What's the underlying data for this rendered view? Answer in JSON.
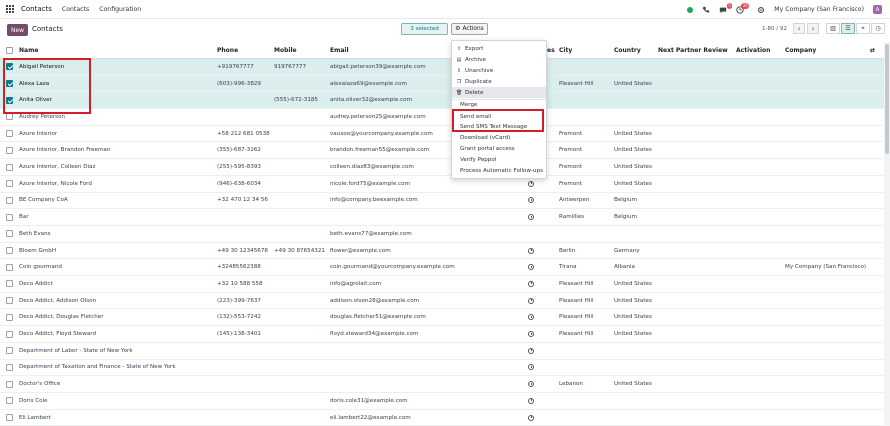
{
  "navbar": {
    "app_name": "Contacts",
    "menu": [
      "Contacts",
      "Configuration"
    ],
    "badge_chat": "5",
    "badge_activity": "26",
    "company": "My Company (San Francisco)",
    "avatar_letter": "A"
  },
  "control": {
    "new_label": "New",
    "title": "Contacts",
    "selected_label": "3 selected",
    "actions_label": "Actions",
    "pager": "1-80 / 92"
  },
  "columns": {
    "name": "Name",
    "phone": "Phone",
    "mobile": "Mobile",
    "email": "Email",
    "activities_partial": "es",
    "city": "City",
    "country": "Country",
    "next_partner_review": "Next Partner Review",
    "activation": "Activation",
    "company": "Company"
  },
  "rows": [
    {
      "name": "Abigail Peterson",
      "phone": "+919767777",
      "mobile": "919767777",
      "email": "abigail.peterson39@example.com",
      "city": "",
      "country": "",
      "company": "",
      "selected": true,
      "activity": false
    },
    {
      "name": "Alexa Laza",
      "phone": "(603)-996-3829",
      "mobile": "",
      "email": "alexalaza69@example.com",
      "city": "Pleasant Hill",
      "country": "United States",
      "company": "",
      "selected": true,
      "activity": false
    },
    {
      "name": "Anita Oliver",
      "phone": "",
      "mobile": "(555)-672-3185",
      "email": "anita.oliver32@example.com",
      "city": "",
      "country": "",
      "company": "",
      "selected": true,
      "activity": false
    },
    {
      "name": "Audrey Peterson",
      "phone": "",
      "mobile": "",
      "email": "audrey.peterson25@example.com",
      "city": "",
      "country": "",
      "company": "",
      "selected": false,
      "activity": false
    },
    {
      "name": "Azure Interior",
      "phone": "+58 212 681 0538",
      "mobile": "",
      "email": "vauxoo@yourcompany.example.com",
      "city": "Fremont",
      "country": "United States",
      "company": "",
      "selected": false,
      "activity": true
    },
    {
      "name": "Azure Interior, Brandon Freeman",
      "phone": "(355)-687-3262",
      "mobile": "",
      "email": "brandon.freeman55@example.com",
      "city": "Fremont",
      "country": "United States",
      "company": "",
      "selected": false,
      "activity": true
    },
    {
      "name": "Azure Interior, Colleen Diaz",
      "phone": "(255)-595-8393",
      "mobile": "",
      "email": "colleen.diaz83@example.com",
      "city": "Fremont",
      "country": "United States",
      "company": "",
      "selected": false,
      "activity": true
    },
    {
      "name": "Azure Interior, Nicole Ford",
      "phone": "(946)-638-6034",
      "mobile": "",
      "email": "nicole.ford75@example.com",
      "city": "Fremont",
      "country": "United States",
      "company": "",
      "selected": false,
      "activity": true
    },
    {
      "name": "BE Company CoA",
      "phone": "+32 470 12 34 56",
      "mobile": "",
      "email": "info@company.beexample.com",
      "city": "Antwerpen",
      "country": "Belgium",
      "company": "",
      "selected": false,
      "activity": true
    },
    {
      "name": "Bar",
      "phone": "",
      "mobile": "",
      "email": "",
      "city": "Ramillies",
      "country": "Belgium",
      "company": "",
      "selected": false,
      "activity": true
    },
    {
      "name": "Beth Evans",
      "phone": "",
      "mobile": "",
      "email": "beth.evans77@example.com",
      "city": "",
      "country": "",
      "company": "",
      "selected": false,
      "activity": false
    },
    {
      "name": "Bloem GmbH",
      "phone": "+49 30 12345678",
      "mobile": "+49 30 87654321",
      "email": "flower@example.com",
      "city": "Berlin",
      "country": "Germany",
      "company": "",
      "selected": false,
      "activity": true
    },
    {
      "name": "Coin gourmand",
      "phone": "+32485562388",
      "mobile": "",
      "email": "coin.gourmand@yourcompany.example.com",
      "city": "Tirana",
      "country": "Albania",
      "company": "My Company (San Francisco)",
      "selected": false,
      "activity": true
    },
    {
      "name": "Deco Addict",
      "phone": "+32 10 588 558",
      "mobile": "",
      "email": "info@agrolait.com",
      "city": "Pleasant Hill",
      "country": "United States",
      "company": "",
      "selected": false,
      "activity": true
    },
    {
      "name": "Deco Addict, Addison Olson",
      "phone": "(223)-399-7637",
      "mobile": "",
      "email": "addison.olson28@example.com",
      "city": "Pleasant Hill",
      "country": "United States",
      "company": "",
      "selected": false,
      "activity": true
    },
    {
      "name": "Deco Addict, Douglas Fletcher",
      "phone": "(132)-553-7242",
      "mobile": "",
      "email": "douglas.fletcher51@example.com",
      "city": "Pleasant Hill",
      "country": "United States",
      "company": "",
      "selected": false,
      "activity": true
    },
    {
      "name": "Deco Addict, Floyd Steward",
      "phone": "(145)-138-3401",
      "mobile": "",
      "email": "floyd.steward34@example.com",
      "city": "Pleasant Hill",
      "country": "United States",
      "company": "",
      "selected": false,
      "activity": true
    },
    {
      "name": "Department of Labor - State of New York",
      "phone": "",
      "mobile": "",
      "email": "",
      "city": "",
      "country": "",
      "company": "",
      "selected": false,
      "activity": true
    },
    {
      "name": "Department of Taxation and Finance - State of New York",
      "phone": "",
      "mobile": "",
      "email": "",
      "city": "",
      "country": "",
      "company": "",
      "selected": false,
      "activity": true
    },
    {
      "name": "Doctor's Office",
      "phone": "",
      "mobile": "",
      "email": "",
      "city": "Lebanon",
      "country": "United States",
      "company": "",
      "selected": false,
      "activity": true
    },
    {
      "name": "Doris Cole",
      "phone": "",
      "mobile": "",
      "email": "doris.cole31@example.com",
      "city": "",
      "country": "",
      "company": "",
      "selected": false,
      "activity": true
    },
    {
      "name": "Eli Lambert",
      "phone": "",
      "mobile": "",
      "email": "eli.lambert22@example.com",
      "city": "",
      "country": "",
      "company": "",
      "selected": false,
      "activity": true
    }
  ],
  "actions_menu": {
    "items": [
      {
        "label": "Export",
        "icon": "upload-icon"
      },
      {
        "label": "Archive",
        "icon": "archive-icon"
      },
      {
        "label": "Unarchive",
        "icon": "unarchive-icon"
      },
      {
        "label": "Duplicate",
        "icon": "copy-icon"
      },
      {
        "label": "Delete",
        "icon": "trash-icon"
      }
    ],
    "extra_items": [
      "Merge",
      "Send email",
      "Send SMS Text Message",
      "Download (vCard)",
      "Grant portal access",
      "Verify Peppol",
      "Process Automatic Follow-ups"
    ]
  },
  "colors": {
    "brand": "#714b67",
    "teal": "#017e84",
    "selected_row": "#d9eeed",
    "highlight": "#d11f2a"
  }
}
